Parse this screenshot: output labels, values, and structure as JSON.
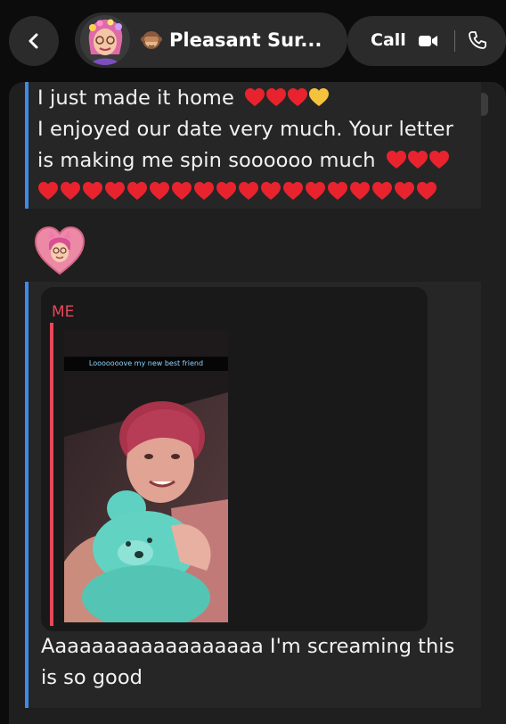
{
  "header": {
    "back_icon": "chevron-left-icon",
    "avatar": "bitmoji-avatar",
    "status_emoji": "see-no-evil-monkey-emoji",
    "title": "Pleasant Sur...",
    "call_label": "Call",
    "video_icon": "video-camera-icon",
    "phone_icon": "phone-icon"
  },
  "messages": [
    {
      "lines": [
        "I just made it home",
        "I enjoyed our date very much. Your letter",
        "is making me spin soooooo much"
      ],
      "emoji_line1": [
        "red-heart",
        "red-heart",
        "red-heart",
        "yellow-heart"
      ],
      "emoji_line3": [
        "red-heart",
        "red-heart",
        "red-heart"
      ],
      "emoji_line4_count": 18
    },
    {
      "sticker": "bitmoji-heart-sticker"
    },
    {
      "quote": {
        "sender": "ME",
        "snap_caption": "Looooooove my new best friend",
        "photo": "photo-person-with-teal-teddy-bear"
      },
      "lines": [
        "Aaaaaaaaaaaaaaaaaa I'm screaming this",
        "is so good"
      ]
    }
  ],
  "colors": {
    "accent_blue": "#3d8ae8",
    "quote_red": "#e5485a",
    "heart_red": "#e8232e",
    "heart_yellow": "#f5c33b"
  }
}
